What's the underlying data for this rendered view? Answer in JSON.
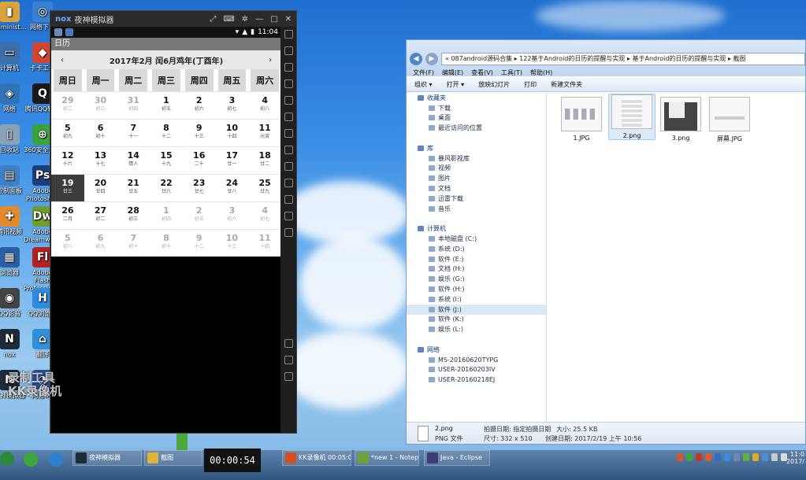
{
  "desktop": {
    "icons": [
      {
        "label": "Administ…",
        "color": "#d9a23a",
        "glyph": "▮"
      },
      {
        "label": "网络下载",
        "color": "#3b7fd1",
        "glyph": "◎"
      },
      {
        "label": "计算机",
        "color": "#3d6ea8",
        "glyph": "▭"
      },
      {
        "label": "卡卡工作",
        "color": "#d6432e",
        "glyph": "◆"
      },
      {
        "label": "网络",
        "color": "#2f74b5",
        "glyph": "◈"
      },
      {
        "label": "腾讯QQ轻聊",
        "color": "#1a1a1a",
        "glyph": "Q"
      },
      {
        "label": "回收站",
        "color": "#8aa2b8",
        "glyph": "▯"
      },
      {
        "label": "360安全卫士",
        "color": "#3ca33c",
        "glyph": "⊕"
      },
      {
        "label": "控制面板",
        "color": "#3f7fc6",
        "glyph": "▤"
      },
      {
        "label": "Adobe Photoshop",
        "color": "#1f3d7a",
        "glyph": "Ps"
      },
      {
        "label": "腾讯视频",
        "color": "#e28a2a",
        "glyph": "✚"
      },
      {
        "label": "Adobe Dreamweaver",
        "color": "#6e9d2b",
        "glyph": "Dw"
      },
      {
        "label": "浏览器",
        "color": "#2a5fa5",
        "glyph": "▦"
      },
      {
        "label": "Adobe Flash Professional",
        "color": "#b52020",
        "glyph": "Fl"
      },
      {
        "label": "QQ影音",
        "color": "#444",
        "glyph": "◉"
      },
      {
        "label": "QQ浏览器",
        "color": "#2d8be0",
        "glyph": "H"
      },
      {
        "label": "nox",
        "color": "#1d2b3b",
        "glyph": "N"
      },
      {
        "label": "翻译",
        "color": "#2f8fd8",
        "glyph": "⌂"
      },
      {
        "label": "夜神模拟器",
        "color": "#1d2b3b",
        "glyph": "N"
      },
      {
        "label": "网易UU",
        "color": "#2e54a3",
        "glyph": "◔"
      }
    ]
  },
  "emulator": {
    "title": "夜神模拟器",
    "brand": "nox",
    "status_time": "11:04",
    "app_title": "日历",
    "calendar": {
      "header": "2017年2月 闰6月鸡年(丁酉年)",
      "prev": "‹",
      "next": "›",
      "weekdays": [
        "周日",
        "周一",
        "周二",
        "周三",
        "周四",
        "周五",
        "周六"
      ],
      "days": [
        {
          "n": "29",
          "l": "初二",
          "o": true
        },
        {
          "n": "30",
          "l": "初三",
          "o": true
        },
        {
          "n": "31",
          "l": "初四",
          "o": true
        },
        {
          "n": "1",
          "l": "初五"
        },
        {
          "n": "2",
          "l": "初六"
        },
        {
          "n": "3",
          "l": "初七"
        },
        {
          "n": "4",
          "l": "初八"
        },
        {
          "n": "5",
          "l": "初九"
        },
        {
          "n": "6",
          "l": "初十"
        },
        {
          "n": "7",
          "l": "十一"
        },
        {
          "n": "8",
          "l": "十二"
        },
        {
          "n": "9",
          "l": "十三"
        },
        {
          "n": "10",
          "l": "十四"
        },
        {
          "n": "11",
          "l": "元宵"
        },
        {
          "n": "12",
          "l": "十六"
        },
        {
          "n": "13",
          "l": "十七"
        },
        {
          "n": "14",
          "l": "情人"
        },
        {
          "n": "15",
          "l": "十九"
        },
        {
          "n": "16",
          "l": "二十"
        },
        {
          "n": "17",
          "l": "廿一"
        },
        {
          "n": "18",
          "l": "廿二"
        },
        {
          "n": "19",
          "l": "廿三",
          "s": true
        },
        {
          "n": "20",
          "l": "廿四"
        },
        {
          "n": "21",
          "l": "廿五"
        },
        {
          "n": "22",
          "l": "廿六"
        },
        {
          "n": "23",
          "l": "廿七"
        },
        {
          "n": "24",
          "l": "廿八"
        },
        {
          "n": "25",
          "l": "廿九"
        },
        {
          "n": "26",
          "l": "二月"
        },
        {
          "n": "27",
          "l": "初二"
        },
        {
          "n": "28",
          "l": "初三"
        },
        {
          "n": "1",
          "l": "初四",
          "o": true
        },
        {
          "n": "2",
          "l": "初五",
          "o": true
        },
        {
          "n": "3",
          "l": "初六",
          "o": true
        },
        {
          "n": "4",
          "l": "初七",
          "o": true
        },
        {
          "n": "5",
          "l": "初八",
          "o": true
        },
        {
          "n": "6",
          "l": "初九",
          "o": true
        },
        {
          "n": "7",
          "l": "初十",
          "o": true
        },
        {
          "n": "8",
          "l": "初十",
          "o": true
        },
        {
          "n": "9",
          "l": "十二",
          "o": true
        },
        {
          "n": "10",
          "l": "十三",
          "o": true
        },
        {
          "n": "11",
          "l": "十四",
          "o": true
        }
      ]
    },
    "watermark": "录制工具\nKK录像机"
  },
  "explorer": {
    "address": "« 087android源码合集 ▸ 122基于Android的日历的提醒与实现 ▸ 基于Android的日历的提醒与实现 ▸ 截图",
    "menu": [
      "文件(F)",
      "编辑(E)",
      "查看(V)",
      "工具(T)",
      "帮助(H)"
    ],
    "toolbar": [
      "组织 ▾",
      "打开 ▾",
      "放映幻灯片",
      "打印",
      "新建文件夹"
    ],
    "nav": [
      {
        "label": "收藏夹",
        "group": true
      },
      {
        "label": "下载"
      },
      {
        "label": "桌面"
      },
      {
        "label": "最近访问的位置"
      },
      {
        "label": "",
        "spacer": true
      },
      {
        "label": "库",
        "group": true
      },
      {
        "label": "暴风影视库"
      },
      {
        "label": "视频"
      },
      {
        "label": "图片"
      },
      {
        "label": "文档"
      },
      {
        "label": "迅雷下载"
      },
      {
        "label": "音乐"
      },
      {
        "label": "",
        "spacer": true
      },
      {
        "label": "计算机",
        "group": true
      },
      {
        "label": "本地磁盘 (C:)"
      },
      {
        "label": "系统 (D:)"
      },
      {
        "label": "软件 (E:)"
      },
      {
        "label": "文档 (H:)"
      },
      {
        "label": "娱乐 (G:)"
      },
      {
        "label": "软件 (H:)"
      },
      {
        "label": "系统 (I:)"
      },
      {
        "label": "软件 (J:)",
        "sel": true
      },
      {
        "label": "软件 (K:)"
      },
      {
        "label": "娱乐 (L:)"
      },
      {
        "label": "",
        "spacer": true
      },
      {
        "label": "网络",
        "group": true
      },
      {
        "label": "MS-20160620TYPG"
      },
      {
        "label": "USER-20160203IV"
      },
      {
        "label": "USER-20160218EJ"
      }
    ],
    "files": [
      {
        "name": "1.JPG"
      },
      {
        "name": "2.png",
        "sel": true
      },
      {
        "name": "3.png"
      },
      {
        "name": "屏幕.JPG"
      }
    ],
    "details": {
      "name": "2.png",
      "type": "PNG 文件",
      "taken_label": "拍摄日期: 指定拍摄日期",
      "dims": "尺寸: 332 x 510",
      "size": "大小: 25.5 KB",
      "created": "创建日期: 2017/2/19 上午 10:56"
    }
  },
  "taskbar": {
    "items": [
      {
        "label": "夜神模拟器",
        "color": "#1d2b3b"
      },
      {
        "label": "截图",
        "color": "#e0b43a"
      },
      {
        "label": "KK录像机 00:05:02",
        "color": "#d0501f"
      },
      {
        "label": "*new 1 - Notepad++",
        "color": "#6ba23a"
      },
      {
        "label": "Java - Eclipse",
        "color": "#3c3c7a"
      }
    ],
    "timer": "00:00:54",
    "clock_time": "11:0",
    "clock_date": "2017/"
  }
}
